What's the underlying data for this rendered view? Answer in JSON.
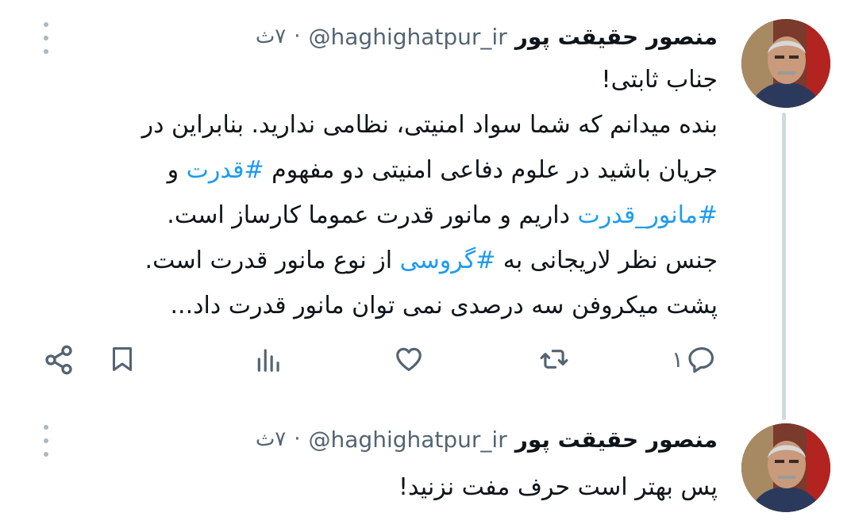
{
  "tweets": [
    {
      "author_name": "منصور حقیقت پور",
      "handle": "@haghighatpur_ir",
      "separator": "·",
      "time": "۷ث",
      "body": {
        "line1": "جناب ثابتی!",
        "line2": "بنده میدانم که شما سواد امنیتی، نظامی ندارید. بنابراین در",
        "line3_pre": "جریان باشید در علوم دفاعی امنیتی دو مفهوم ",
        "line3_tag": "#قدرت",
        "line3_post": " و",
        "line4_tag": "#مانور_قدرت",
        "line4_post": " داریم و مانور قدرت عموما کارساز است.",
        "line5_pre": "جنس نظر لاریجانی به ",
        "line5_tag": "#گروسی",
        "line5_post": " از نوع مانور قدرت است.",
        "line6": "پشت میکروفن سه درصدی نمی توان مانور قدرت داد..."
      },
      "actions": {
        "reply_count": "۱",
        "reply_icon": "reply-icon",
        "retweet_icon": "retweet-icon",
        "like_icon": "heart-icon",
        "views_icon": "views-icon",
        "bookmark_icon": "bookmark-icon",
        "share_icon": "share-icon"
      }
    },
    {
      "author_name": "منصور حقیقت پور",
      "handle": "@haghighatpur_ir",
      "separator": "·",
      "time": "۷ث",
      "body": {
        "line1": "پس بهتر است حرف مفت نزنید!"
      }
    }
  ],
  "colors": {
    "text": "#0f1419",
    "muted": "#536471",
    "hashtag": "#1d9bf0",
    "thread_line": "#cfd9de"
  }
}
